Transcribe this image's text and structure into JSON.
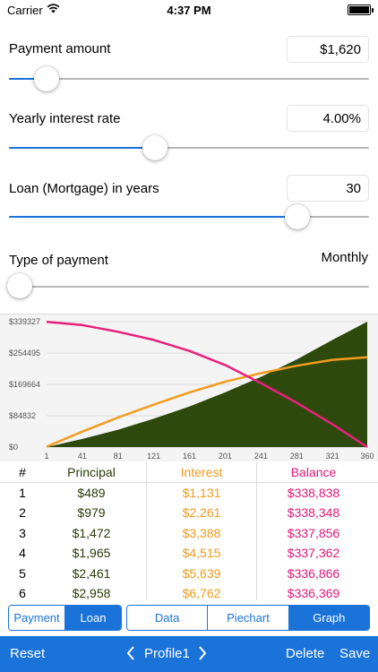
{
  "status_bar": {
    "carrier": "Carrier",
    "time": "4:37 PM"
  },
  "inputs": {
    "payment_amount": {
      "label": "Payment amount",
      "value": "$1,620",
      "slider_fraction": 0.105
    },
    "interest_rate": {
      "label": "Yearly interest rate",
      "value": "4.00%",
      "slider_fraction": 0.405
    },
    "loan_years": {
      "label": "Loan (Mortgage) in years",
      "value": "30",
      "slider_fraction": 0.8
    },
    "payment_type": {
      "label": "Type of payment",
      "value": "Monthly",
      "slider_fraction": 0.0
    }
  },
  "chart_data": {
    "type": "area",
    "x_ticks": [
      "1",
      "41",
      "81",
      "121",
      "161",
      "201",
      "241",
      "281",
      "321",
      "360"
    ],
    "y_ticks": [
      "$0",
      "$84832",
      "$169664",
      "$254495",
      "$339327"
    ],
    "xlim": [
      1,
      360
    ],
    "ylim": [
      0,
      339327
    ],
    "grid": true,
    "series": [
      {
        "kind": "area",
        "color": "#2d4a0c",
        "x": [
          1,
          41,
          81,
          121,
          161,
          201,
          241,
          281,
          321,
          360
        ],
        "values": [
          0,
          22000,
          47000,
          77000,
          110000,
          148000,
          190000,
          237000,
          290000,
          339327
        ]
      },
      {
        "kind": "line",
        "color": "#f39c1f",
        "x": [
          1,
          41,
          81,
          121,
          161,
          201,
          241,
          281,
          321,
          360
        ],
        "values": [
          1131,
          42000,
          80000,
          115000,
          148000,
          177000,
          200000,
          220000,
          236000,
          243000
        ]
      },
      {
        "kind": "line",
        "color": "#e8207b",
        "x": [
          1,
          41,
          81,
          121,
          161,
          201,
          241,
          281,
          321,
          360
        ],
        "values": [
          338838,
          330000,
          312000,
          290000,
          260000,
          222000,
          173000,
          120000,
          62000,
          0
        ]
      }
    ]
  },
  "table": {
    "headers": [
      "#",
      "Principal",
      "Interest",
      "Balance"
    ],
    "rows": [
      [
        "1",
        "$489",
        "$1,131",
        "$338,838"
      ],
      [
        "2",
        "$979",
        "$2,261",
        "$338,348"
      ],
      [
        "3",
        "$1,472",
        "$3,388",
        "$337,856"
      ],
      [
        "4",
        "$1,965",
        "$4,515",
        "$337,362"
      ],
      [
        "5",
        "$2,461",
        "$5,639",
        "$336,866"
      ],
      [
        "6",
        "$2,958",
        "$6,762",
        "$336,369"
      ]
    ]
  },
  "segments_left": [
    {
      "label": "Payment",
      "selected": false
    },
    {
      "label": "Loan",
      "selected": true
    }
  ],
  "segments_right": [
    {
      "label": "Data",
      "selected": false
    },
    {
      "label": "Piechart",
      "selected": false
    },
    {
      "label": "Graph",
      "selected": true
    }
  ],
  "toolbar": {
    "reset": "Reset",
    "profile": "Profile1",
    "delete": "Delete",
    "save": "Save"
  },
  "colors": {
    "accent": "#1a73d9",
    "principal": "#2b3b0a",
    "interest": "#f09a1c",
    "balance": "#e0187a"
  }
}
